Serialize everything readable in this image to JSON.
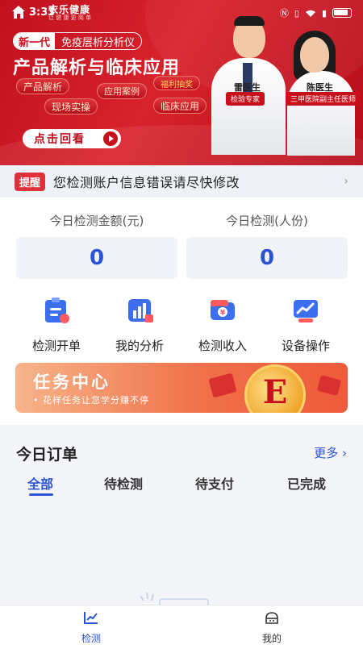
{
  "status_bar": {
    "time": "3:33",
    "app_logo_text": "衣乐健康",
    "app_logo_sub": "让 健 康 更 简 单"
  },
  "banner": {
    "tag_new": "新一代",
    "tag_product": "免疫层析分析仪",
    "title": "产品解析与临床应用",
    "chips": [
      "产品解析",
      "应用案例",
      "福利抽奖",
      "现场实操",
      "临床应用"
    ],
    "replay_button": "点击回看",
    "doctors": [
      {
        "name": "雷医生",
        "role": "检验专家"
      },
      {
        "name": "陈医生",
        "role": "三甲医院副主任医师"
      }
    ]
  },
  "notice": {
    "badge": "提醒",
    "text": "您检测账户信息错误请尽快修改"
  },
  "stats": [
    {
      "label": "今日检测金额(元)",
      "value": "0"
    },
    {
      "label": "今日检测(人份)",
      "value": "0"
    }
  ],
  "menu": [
    {
      "label": "检测开单",
      "icon": "clipboard-icon"
    },
    {
      "label": "我的分析",
      "icon": "analysis-chart-icon"
    },
    {
      "label": "检测收入",
      "icon": "income-wallet-icon"
    },
    {
      "label": "设备操作",
      "icon": "device-trend-icon"
    }
  ],
  "task_center": {
    "title": "任务中心",
    "subtitle": "花样任务让您学分赚不停",
    "coin_letter": "E"
  },
  "orders": {
    "title": "今日订单",
    "more": "更多",
    "tabs": [
      "全部",
      "待检测",
      "待支付",
      "已完成"
    ],
    "active_tab": "全部"
  },
  "bottom_nav": [
    {
      "label": "检测",
      "icon": "chart-line-icon",
      "active": true
    },
    {
      "label": "我的",
      "icon": "profile-hat-icon",
      "active": false
    }
  ],
  "colors": {
    "brand_red": "#c8101c",
    "accent_blue": "#2c53d6"
  }
}
